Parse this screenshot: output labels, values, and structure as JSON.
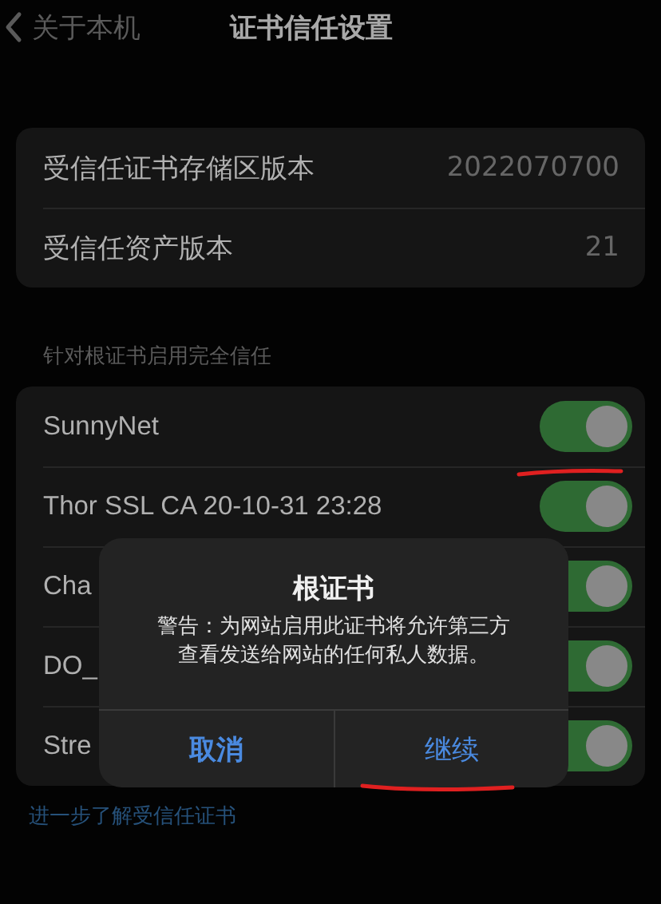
{
  "nav": {
    "back": "关于本机",
    "title": "证书信任设置"
  },
  "info_rows": [
    {
      "label": "受信任证书存储区版本",
      "value": "2022070700"
    },
    {
      "label": "受信任资产版本",
      "value": "21"
    }
  ],
  "section_header": "针对根证书启用完全信任",
  "cert_rows": [
    {
      "name": "SunnyNet",
      "on": true
    },
    {
      "name": "Thor SSL CA 20-10-31 23:28",
      "on": true
    },
    {
      "name": "Cha",
      "on": true
    },
    {
      "name": "DO_",
      "on": true
    },
    {
      "name": "Stre",
      "on": true
    }
  ],
  "link": "进一步了解受信任证书",
  "alert": {
    "title": "根证书",
    "message": "警告：为网站启用此证书将允许第三方查看发送给网站的任何私人数据。",
    "buttons": [
      "取消",
      "继续"
    ]
  }
}
